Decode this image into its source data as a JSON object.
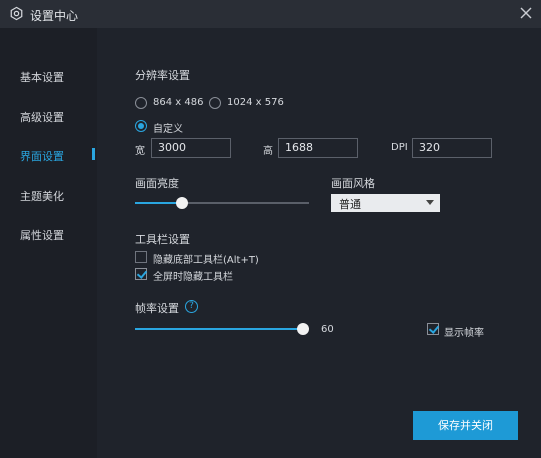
{
  "window": {
    "title": "设置中心"
  },
  "sidebar": {
    "items": [
      {
        "label": "基本设置"
      },
      {
        "label": "高级设置"
      },
      {
        "label": "界面设置"
      },
      {
        "label": "主题美化"
      },
      {
        "label": "属性设置"
      }
    ],
    "active_index": 2
  },
  "resolution": {
    "heading": "分辨率设置",
    "options": [
      "864 x 486",
      "1024 x 576",
      "自定义"
    ],
    "selected": "自定义",
    "width_label": "宽",
    "width_value": "3000",
    "height_label": "高",
    "height_value": "1688",
    "dpi_label": "DPI",
    "dpi_value": "320"
  },
  "brightness": {
    "label": "画面亮度",
    "level_fraction": 0.27
  },
  "style": {
    "label": "画面风格",
    "selected": "普通"
  },
  "toolbar": {
    "heading": "工具栏设置",
    "hide_bottom_label": "隐藏底部工具栏(Alt+T)",
    "hide_bottom_checked": false,
    "fullscreen_hide_label": "全屏时隐藏工具栏",
    "fullscreen_hide_checked": true
  },
  "framerate": {
    "label": "帧率设置",
    "value": "60",
    "level_fraction": 1.0,
    "show_fps_label": "显示帧率",
    "show_fps_checked": true
  },
  "actions": {
    "save_label": "保存并关闭"
  },
  "colors": {
    "accent": "#2aa6e0",
    "button": "#1e9ad6",
    "background": "#1f232b"
  }
}
